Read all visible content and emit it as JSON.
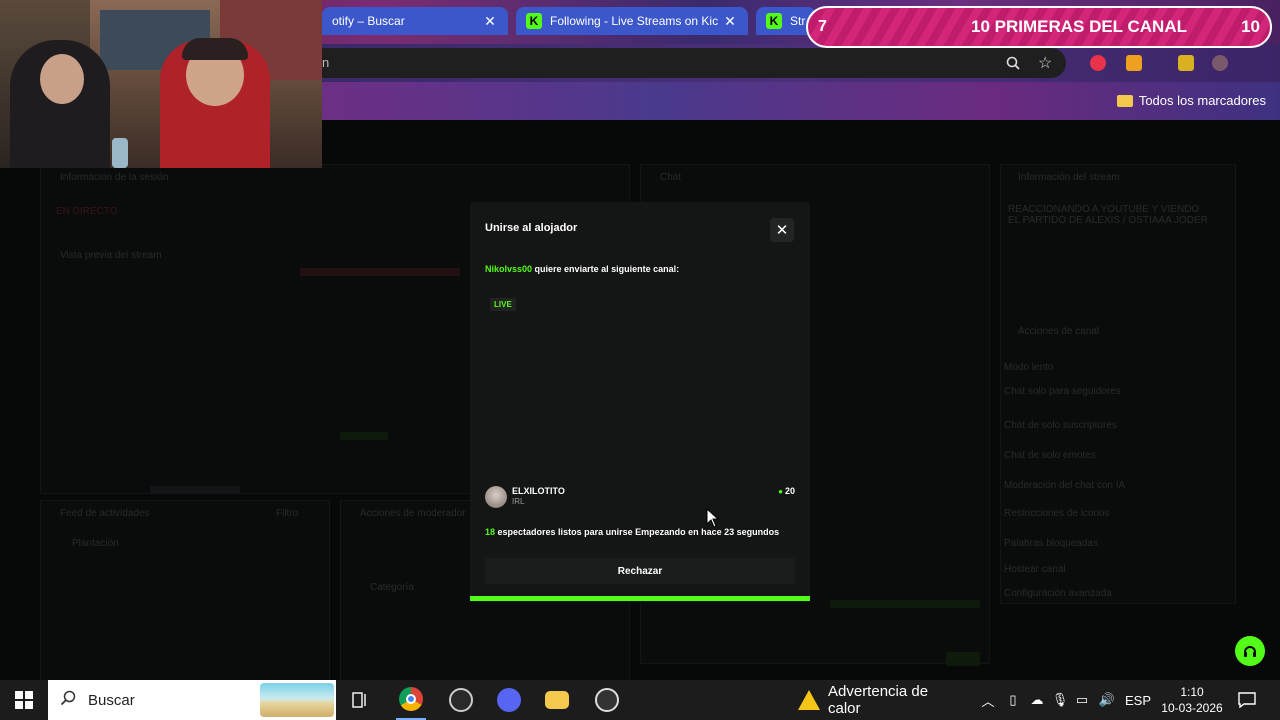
{
  "browser": {
    "tabs": [
      {
        "title": "otify – Buscar",
        "close": "✕"
      },
      {
        "title": "Following - Live Streams on Kic",
        "close": "✕"
      },
      {
        "title": "Stre",
        "close": ""
      }
    ],
    "bookmarks_label": "Todos los marcadores"
  },
  "promo": {
    "left_number": "7",
    "title": "10 PRIMERAS DEL CANAL",
    "right_number": "10"
  },
  "modal": {
    "title": "Unirse al alojador",
    "close": "✕",
    "sender": "Nikolvss00",
    "message": "quiere enviarte al siguiente canal:",
    "live_badge": "LIVE",
    "channel": {
      "name": "ELXILOTITO",
      "category": "IRL",
      "viewers": "20"
    },
    "ready_count": "18",
    "ready_text": "espectadores listos para unirse",
    "starting_text": "Empezando en hace 23 segundos",
    "reject_label": "Rechazar",
    "progress_percent": 100
  },
  "dashboard_dim": {
    "left_title": "Información de la sesión",
    "live_tag": "EN DIRECTO",
    "preview_title": "Vista previa del stream",
    "feed_title": "Feed de actividades",
    "feed_filter": "Filtro",
    "feed_item": "Plantación",
    "mod_title": "Acciones de moderador",
    "chat_title": "Chat",
    "info_title": "Información del stream",
    "info_text": "REACCIONANDO A YOUTUBE Y VIENDO EL PARTIDO DE ALEXIS / OSTIAAA JODER",
    "category_label": "Categoría",
    "mod_actions_title": "Acciones de canal",
    "settings": [
      "Modo lento",
      "Chat solo para seguidores",
      "Chat de solo suscriptores",
      "Chat de solo emotes",
      "Moderación del chat con IA",
      "Restricciones de iconos",
      "Palabras bloqueadas",
      "Hostear canal",
      "Configuración avanzada"
    ]
  },
  "taskbar": {
    "search_placeholder": "Buscar",
    "heat_warning": "Advertencia de calor",
    "language": "ESP",
    "time": "1:10",
    "date": "10-03-2026"
  },
  "icons": {
    "kick_favicon": "kick-logo-icon",
    "help": "headset-icon"
  },
  "colors": {
    "kick_green": "#53fc18",
    "modal_bg": "#141515",
    "promo_pink": "#d3267a"
  }
}
